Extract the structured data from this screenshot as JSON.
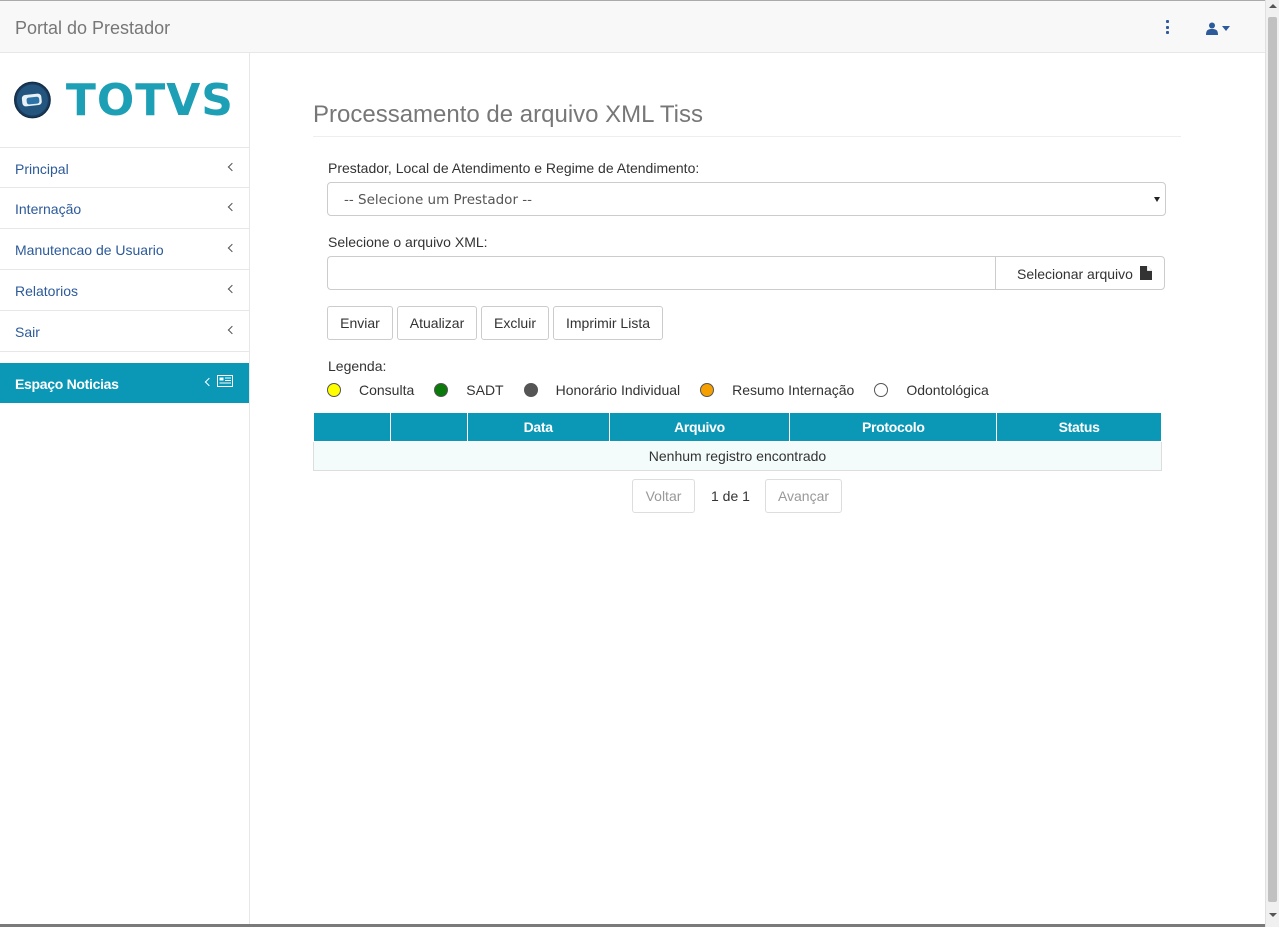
{
  "header": {
    "brand": "Portal do Prestador"
  },
  "logo": {
    "text": "TOTVS"
  },
  "sidebar": {
    "items": [
      {
        "label": "Principal"
      },
      {
        "label": "Internação"
      },
      {
        "label": "Manutencao de Usuario"
      },
      {
        "label": "Relatorios"
      },
      {
        "label": "Sair"
      }
    ],
    "news": {
      "label": "Espaço Noticias"
    }
  },
  "main": {
    "title": "Processamento de arquivo XML Tiss",
    "prestador_label": "Prestador, Local de Atendimento e Regime de Atendimento:",
    "prestador_select_value": "-- Selecione um Prestador --",
    "file_label": "Selecione o arquivo XML:",
    "file_input_value": "",
    "file_button_label": "Selecionar arquivo",
    "buttons": {
      "enviar": "Enviar",
      "atualizar": "Atualizar",
      "excluir": "Excluir",
      "imprimir": "Imprimir Lista"
    },
    "legend_title": "Legenda:",
    "legend": [
      {
        "label": "Consulta",
        "color": "#ffff00"
      },
      {
        "label": "SADT",
        "color": "#0a7a0a"
      },
      {
        "label": "Honorário Individual",
        "color": "#555555"
      },
      {
        "label": "Resumo Internação",
        "color": "#f5a000"
      },
      {
        "label": "Odontológica",
        "color": "#ffffff"
      }
    ],
    "table": {
      "columns": [
        "",
        "",
        "Data",
        "Arquivo",
        "Protocolo",
        "Status"
      ],
      "empty_message": "Nenhum registro encontrado"
    },
    "pager": {
      "prev": "Voltar",
      "info": "1 de 1",
      "next": "Avançar"
    }
  },
  "colors": {
    "accent": "#0b97b6",
    "link": "#2c5a9a"
  }
}
